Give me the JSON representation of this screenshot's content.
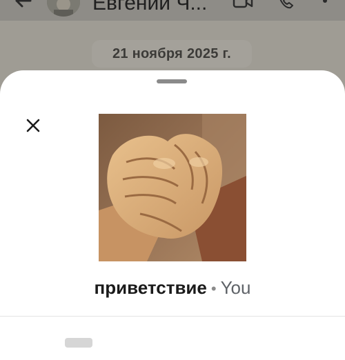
{
  "chat": {
    "contact_name": "Евгений Ч...",
    "date_chip": "21 ноября 2025 г.",
    "icons": [
      "back-arrow-icon",
      "avatar",
      "video-call-icon",
      "phone-icon",
      "more-vert-icon"
    ]
  },
  "sheet": {
    "close_icon": "close-icon",
    "sticker_image": "clasped-hands-photo",
    "sticker_name": "приветствие",
    "separator": "•",
    "author": "You"
  },
  "colors": {
    "sheet_bg": "#ffffff",
    "scrim": "#9f9c94",
    "text_primary": "#1b1b1b",
    "text_secondary": "#5f6368"
  }
}
